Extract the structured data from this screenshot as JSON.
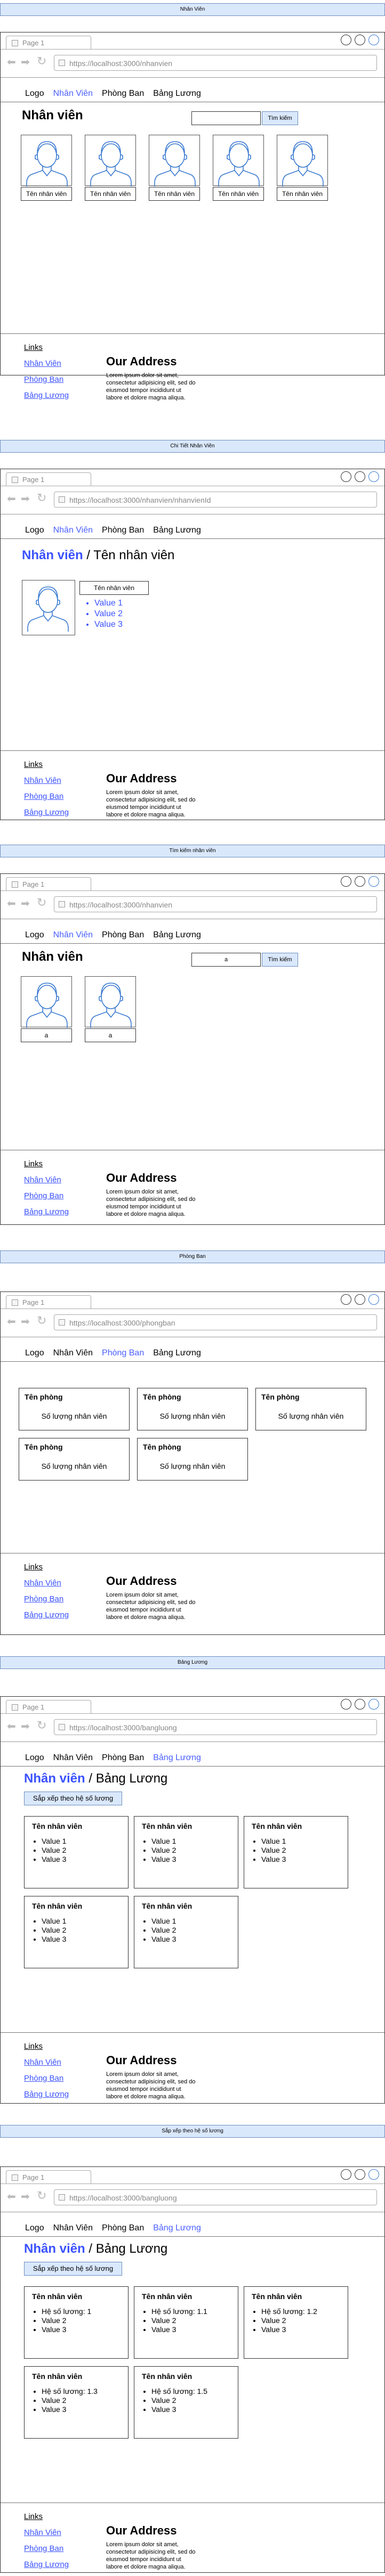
{
  "browser": {
    "tab_label": "Page 1",
    "back_icon": "arrow-left-icon",
    "forward_icon": "arrow-right-icon",
    "reload_icon": "reload-icon"
  },
  "nav": {
    "logo": "Logo",
    "items": [
      "Nhân Viên",
      "Phòng Ban",
      "Bảng Lương"
    ]
  },
  "footer": {
    "links_title": "Links",
    "links": [
      "Nhân Viên",
      "Phòng Ban",
      "Bảng Lương"
    ],
    "address_title": "Our Address",
    "address_text": "Lorem ipsum dolor sit amet, consectetur adipisicing elit, sed do eiusmod tempor incididunt ut labore et dolore magna aliqua."
  },
  "sections": [
    {
      "lane": "Nhân Viên",
      "url": "https://localhost:3000/nhanvien",
      "active_nav": 0,
      "heading": "Nhân viên",
      "search_value": "",
      "search_button": "Tìm kiếm",
      "employees": [
        "Tên nhân viên",
        "Tên nhân viên",
        "Tên nhân viên",
        "Tên nhân viên",
        "Tên nhân viên"
      ]
    },
    {
      "lane": "Chi Tiết Nhân Viên",
      "url": "https://localhost:3000/nhanvien/nhanvienId",
      "active_nav": 0,
      "heading_link": "Nhân viên",
      "heading_rest": " / Tên nhân viên",
      "name_box": "Tên nhân viên",
      "values": [
        "Value 1",
        "Value 2",
        "Value 3"
      ]
    },
    {
      "lane": "Tìm kiếm nhân viên",
      "url": "https://localhost:3000/nhanvien",
      "active_nav": 0,
      "heading": "Nhân viên",
      "search_value": "a",
      "search_button": "Tìm kiếm",
      "employees": [
        "a",
        "a"
      ]
    },
    {
      "lane": "Phòng Ban",
      "url": "https://localhost:3000/phongban",
      "active_nav": 1,
      "cards": [
        {
          "title": "Tên phòng",
          "sub": "Số lượng nhân viên"
        },
        {
          "title": "Tên phòng",
          "sub": "Số lượng nhân viên"
        },
        {
          "title": "Tên phòng",
          "sub": "Số lượng nhân viên"
        },
        {
          "title": "Tên phòng",
          "sub": "Số lượng nhân viên"
        },
        {
          "title": "Tên phòng",
          "sub": "Số lượng nhân viên"
        }
      ]
    },
    {
      "lane": "Bảng Lương",
      "url": "https://localhost:3000/bangluong",
      "active_nav": 2,
      "heading_link": "Nhân viên",
      "heading_rest": " / Bảng Lương",
      "sort_button": "Sắp xếp theo hệ số lương",
      "cards": [
        {
          "title": "Tên nhân viên",
          "items": [
            "Value 1",
            "Value 2",
            "Value 3"
          ]
        },
        {
          "title": "Tên nhân viên",
          "items": [
            "Value 1",
            "Value 2",
            "Value 3"
          ]
        },
        {
          "title": "Tên nhân viên",
          "items": [
            "Value 1",
            "Value 2",
            "Value 3"
          ]
        },
        {
          "title": "Tên nhân viên",
          "items": [
            "Value 1",
            "Value 2",
            "Value 3"
          ]
        },
        {
          "title": "Tên nhân viên",
          "items": [
            "Value 1",
            "Value 2",
            "Value 3"
          ]
        }
      ]
    },
    {
      "lane": "Sắp xếp theo hệ số lương",
      "url": "https://localhost:3000/bangluong",
      "active_nav": 2,
      "heading_link": "Nhân viên",
      "heading_rest": " / Bảng Lương",
      "sort_button": "Sắp xếp theo hệ số lương",
      "cards": [
        {
          "title": "Tên nhân viên",
          "items": [
            "Hệ số lương: 1",
            "Value 2",
            "Value 3"
          ]
        },
        {
          "title": "Tên nhân viên",
          "items": [
            "Hệ số lương: 1.1",
            "Value 2",
            "Value 3"
          ]
        },
        {
          "title": "Tên nhân viên",
          "items": [
            "Hệ số lương: 1.2",
            "Value 2",
            "Value 3"
          ]
        },
        {
          "title": "Tên nhân viên",
          "items": [
            "Hệ số lương: 1.3",
            "Value 2",
            "Value 3"
          ]
        },
        {
          "title": "Tên nhân viên",
          "items": [
            "Hệ số lương: 1.5",
            "Value 2",
            "Value 3"
          ]
        }
      ]
    }
  ]
}
